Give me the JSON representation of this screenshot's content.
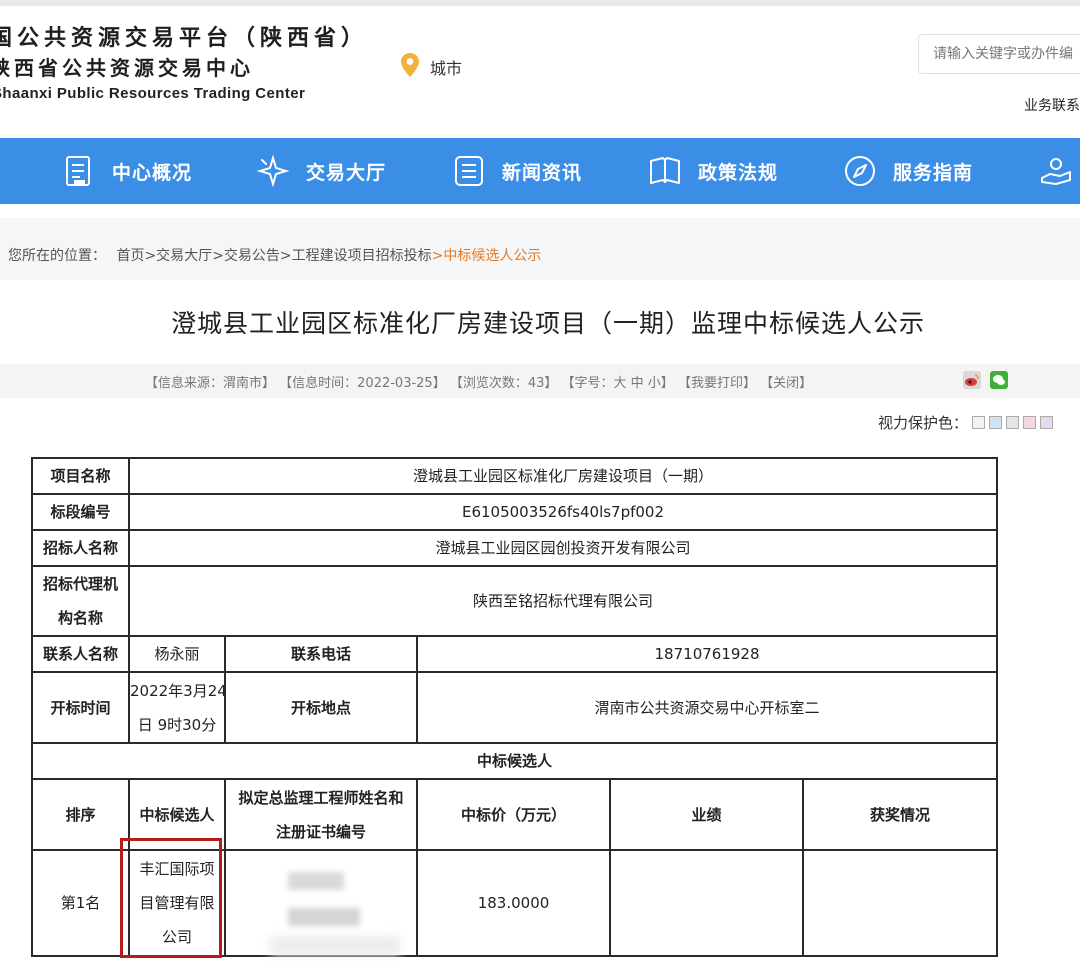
{
  "header": {
    "logo_line1": "国公共资源交易平台（陕西省）",
    "logo_line2": "陕西省公共资源交易中心",
    "logo_line3": "Shaanxi Public Resources Trading Center",
    "city_label": "城市",
    "search_placeholder": "请输入关键字或办件编",
    "business_link": "业务联系"
  },
  "nav": {
    "items": [
      {
        "label": "中心概况",
        "icon": "document-icon"
      },
      {
        "label": "交易大厅",
        "icon": "sparkle-icon"
      },
      {
        "label": "新闻资讯",
        "icon": "list-icon"
      },
      {
        "label": "政策法规",
        "icon": "book-icon"
      },
      {
        "label": "服务指南",
        "icon": "compass-icon"
      },
      {
        "label": "",
        "icon": "hand-icon"
      }
    ]
  },
  "breadcrumb": {
    "prefix": "您所在的位置：",
    "items": [
      "首页",
      ">交易大厅",
      ">交易公告",
      ">工程建设项目招标投标",
      ">中标候选人公示"
    ]
  },
  "article": {
    "title": "澄城县工业园区标准化厂房建设项目（一期）监理中标候选人公示",
    "source": "【信息来源：渭南市】",
    "time": "【信息时间：2022-03-25】",
    "views": "【浏览次数：43】",
    "fontsize": "【字号：大 中 小】",
    "print": "【我要打印】",
    "close": "【关闭】",
    "vision_label": "视力保护色：",
    "swatch_colors": [
      "#f2f2f2",
      "#cfe3f3",
      "#e6e6e6",
      "#f3d9df",
      "#e4d9ef"
    ]
  },
  "table": {
    "project_name_key": "项目名称",
    "project_name": "澄城县工业园区标准化厂房建设项目（一期）",
    "section_no_key": "标段编号",
    "section_no": "E6105003526fs40ls7pf002",
    "tenderer_key": "招标人名称",
    "tenderer": "澄城县工业园区园创投资开发有限公司",
    "agency_key_l1": "招标代理机",
    "agency_key_l2": "构名称",
    "agency": "陕西至铭招标代理有限公司",
    "contact_key": "联系人名称",
    "contact": "杨永丽",
    "phone_key": "联系电话",
    "phone": "18710761928",
    "open_time_key": "开标时间",
    "open_time_l1": "2022年3月24",
    "open_time_l2": "日 9时30分",
    "open_place_key": "开标地点",
    "open_place": "渭南市公共资源交易中心开标室二",
    "candidates_header": "中标候选人",
    "col_rank": "排序",
    "col_candidate": "中标候选人",
    "col_engineer_l1": "拟定总监理工程师姓名和",
    "col_engineer_l2": "注册证书编号",
    "col_price": "中标价（万元）",
    "col_performance": "业绩",
    "col_awards": "获奖情况",
    "row1_rank": "第1名",
    "row1_candidate_l1": "丰汇国际项",
    "row1_candidate_l2": "目管理有限",
    "row1_candidate_l3": "公司",
    "row1_price": "183.0000"
  }
}
